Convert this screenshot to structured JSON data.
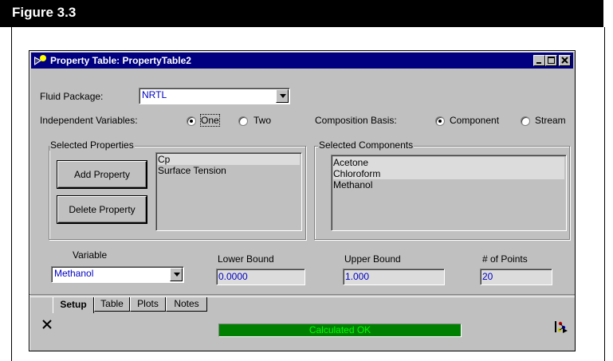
{
  "figure": {
    "title": "Figure 3.3"
  },
  "window": {
    "title": "Property Table: PropertyTable2",
    "buttons": {
      "minimize": "_",
      "maximize": "□",
      "close": "✕"
    }
  },
  "fluid_package": {
    "label": "Fluid Package:",
    "value": "NRTL"
  },
  "independent_variables": {
    "label": "Independent Variables:",
    "option_one": "One",
    "option_two": "Two",
    "selected": "One"
  },
  "composition_basis": {
    "label": "Composition Basis:",
    "option_component": "Component",
    "option_stream": "Stream",
    "selected": "Component"
  },
  "selected_properties": {
    "title": "Selected Properties",
    "add_button": "Add Property",
    "delete_button": "Delete Property",
    "items": [
      "Cp",
      "Surface Tension"
    ]
  },
  "selected_components": {
    "title": "Selected Components",
    "items": [
      "Acetone",
      "Chloroform",
      "Methanol"
    ]
  },
  "variable": {
    "label": "Variable",
    "value": "Methanol"
  },
  "lower_bound": {
    "label": "Lower Bound",
    "value": "0.0000"
  },
  "upper_bound": {
    "label": "Upper Bound",
    "value": "1.000"
  },
  "num_points": {
    "label": "# of Points",
    "value": "20"
  },
  "tabs": [
    {
      "label": "Setup",
      "active": true
    },
    {
      "label": "Table"
    },
    {
      "label": "Plots"
    },
    {
      "label": "Notes"
    }
  ],
  "status": {
    "text": "Calculated OK",
    "color": "#008000"
  },
  "footer": {
    "delete_icon": "x-icon",
    "object_icon": "molecule-icon",
    "play_icon": "play-icon"
  }
}
